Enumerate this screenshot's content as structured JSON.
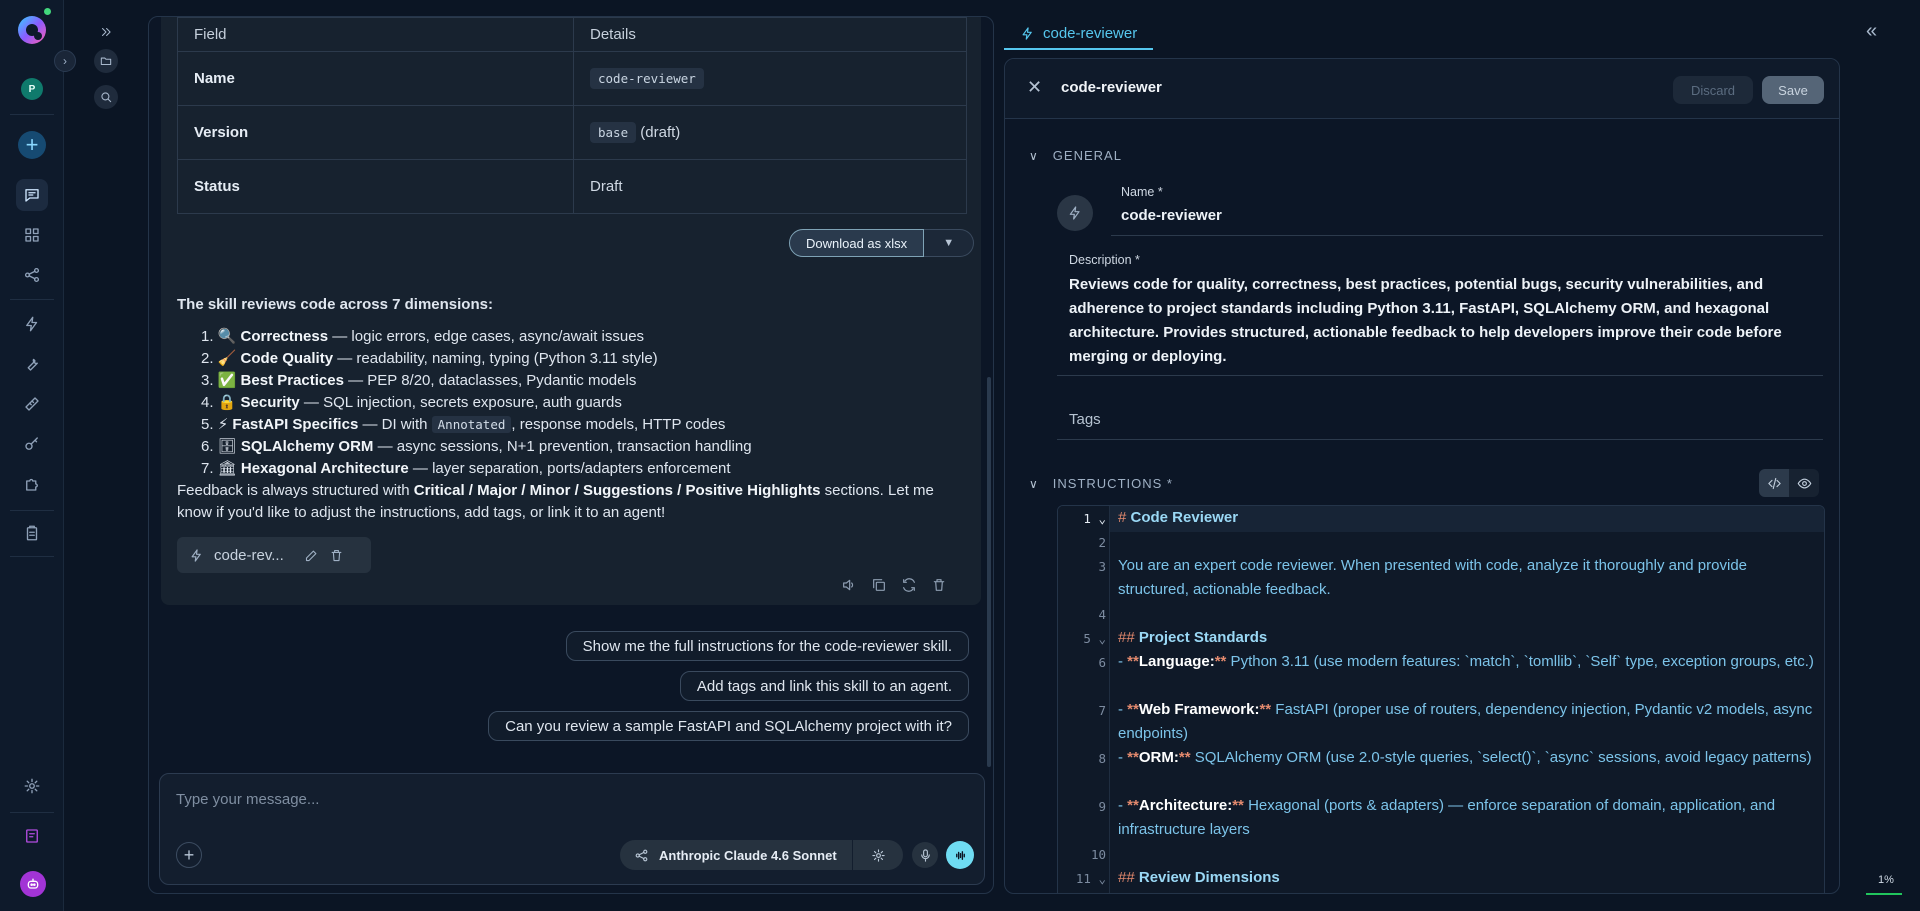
{
  "sidebar": {
    "avatar_initial": "P",
    "items": [
      "chat-icon",
      "grid-icon",
      "share-graph-icon",
      "bolt-icon",
      "wrench-icon",
      "ruler-icon",
      "key-icon",
      "puzzle-icon",
      "clipboard-icon"
    ],
    "bottom": [
      "settings-icon",
      "notebook-icon",
      "bot-icon"
    ]
  },
  "chat": {
    "table": {
      "header": [
        "Field",
        "Details"
      ],
      "rows": [
        {
          "field": "Name",
          "code": "code-reviewer",
          "extra": ""
        },
        {
          "field": "Version",
          "code": "base",
          "extra": "(draft)"
        },
        {
          "field": "Status",
          "code": "",
          "extra": "Draft"
        }
      ]
    },
    "download_label": "Download as xlsx",
    "summary_title": "The skill reviews code across 7 dimensions:",
    "dimensions": [
      {
        "num": "1.",
        "emoji": "🔍",
        "title": "Correctness",
        "desc": " — logic errors, edge cases, async/await issues"
      },
      {
        "num": "2.",
        "emoji": "🧹",
        "title": "Code Quality",
        "desc": " — readability, naming, typing (Python 3.11 style)"
      },
      {
        "num": "3.",
        "emoji": "✅",
        "title": "Best Practices",
        "desc": " — PEP 8/20, dataclasses, Pydantic models"
      },
      {
        "num": "4.",
        "emoji": "🔒",
        "title": "Security",
        "desc": " — SQL injection, secrets exposure, auth guards"
      },
      {
        "num": "5.",
        "emoji": "⚡",
        "title": "FastAPI Specifics",
        "desc_a": " — DI with ",
        "code": "Annotated",
        "desc_b": ", response models, HTTP codes"
      },
      {
        "num": "6.",
        "emoji": "🗄",
        "title": "SQLAlchemy ORM",
        "desc": " — async sessions, N+1 prevention, transaction handling"
      },
      {
        "num": "7.",
        "emoji": "🏛",
        "title": "Hexagonal Architecture",
        "desc": " — layer separation, ports/adapters enforcement"
      }
    ],
    "feedback_a": "Feedback is always structured with ",
    "feedback_bold": "Critical / Major / Minor / Suggestions / Positive Highlights",
    "feedback_b": " sections. Let me know if you'd like to adjust the instructions, add tags, or link it to an agent!",
    "skill_chip": "code-rev...",
    "suggestions": [
      "Show me the full instructions for the code-reviewer skill.",
      "Add tags and link this skill to an agent.",
      "Can you review a sample FastAPI and SQLAlchemy project with it?"
    ],
    "composer_placeholder": "Type your message...",
    "model": "Anthropic Claude 4.6 Sonnet"
  },
  "editor": {
    "tab_label": "code-reviewer",
    "header_name": "code-reviewer",
    "discard": "Discard",
    "save": "Save",
    "general": "GENERAL",
    "name_label": "Name *",
    "name_value": "code-reviewer",
    "description_label": "Description *",
    "description": "Reviews code for quality, correctness, best practices, potential bugs, security vulnerabilities, and adherence to project standards including Python 3.11, FastAPI, SQLAlchemy ORM, and hexagonal architecture. Provides structured, actionable feedback to help developers improve their code before merging or deploying.",
    "tags_label": "Tags",
    "instructions": "INSTRUCTIONS *",
    "line_numbers": [
      "1",
      "2",
      "3",
      "4",
      "5",
      "6",
      "7",
      "8",
      "9",
      "10",
      "11"
    ],
    "code": {
      "l1": "Code Reviewer",
      "l3": "You are an expert code reviewer. When presented with code, analyze it thoroughly and provide structured, actionable feedback.",
      "l5": "Project Standards",
      "l6_key": "Language:",
      "l6_text": " Python 3.11 (use modern features: `match`, `tomllib`, `Self` type, exception groups, etc.)",
      "l7_key": "Web Framework:",
      "l7_text": " FastAPI (proper use of routers, dependency injection, Pydantic v2 models, async endpoints)",
      "l8_key": "ORM:",
      "l8_text": " SQLAlchemy ORM (use 2.0-style queries, `select()`, `async` sessions, avoid legacy patterns)",
      "l9_key": "Architecture:",
      "l9_text": " Hexagonal (ports & adapters) — enforce separation of domain, application, and infrastructure layers",
      "l11": "Review Dimensions"
    }
  },
  "status": {
    "percent": "1%"
  },
  "colors": {
    "accent": "#56c7ee",
    "brand": "#a234d6",
    "green": "#21c55d"
  }
}
